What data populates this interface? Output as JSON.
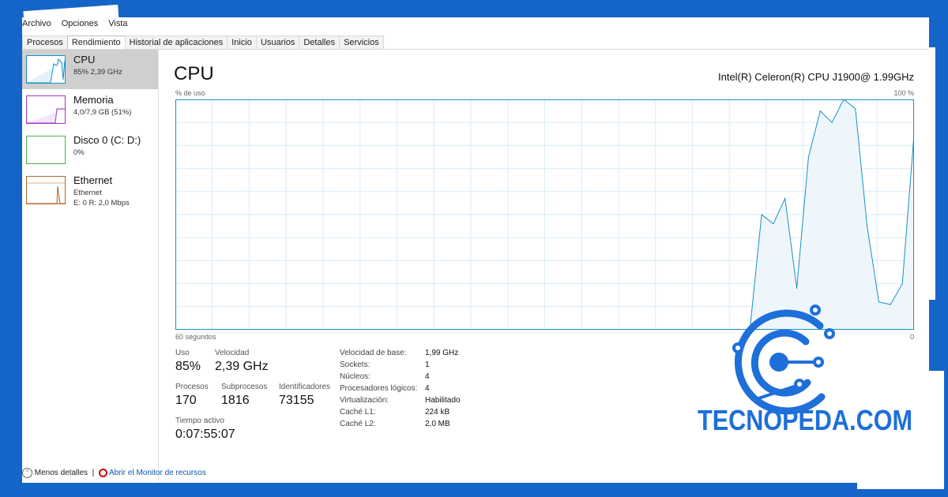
{
  "menu": [
    "Archivo",
    "Opciones",
    "Vista"
  ],
  "tabs": [
    "Procesos",
    "Rendimiento",
    "Historial de aplicaciones",
    "Inicio",
    "Usuarios",
    "Detalles",
    "Servicios"
  ],
  "active_tab_index": 1,
  "sidebar": {
    "items": [
      {
        "title": "CPU",
        "sub1": "85% 2,39 GHz",
        "sub2": "",
        "color": "#1a8fc8"
      },
      {
        "title": "Memoria",
        "sub1": "4,0/7,9 GB (51%)",
        "sub2": "",
        "color": "#a035c8"
      },
      {
        "title": "Disco 0 (C: D:)",
        "sub1": "0%",
        "sub2": "",
        "color": "#4caf50"
      },
      {
        "title": "Ethernet",
        "sub1": "Ethernet",
        "sub2": "E: 0 R: 2,0 Mbps",
        "color": "#b36a2a"
      }
    ]
  },
  "panel": {
    "title": "CPU",
    "processor": "Intel(R) Celeron(R) CPU J1900@ 1.99GHz",
    "y_label": "% de uso",
    "y_max_label": "100 %",
    "x_label": "60 segundos",
    "x_end_label": "0"
  },
  "chart_data": {
    "type": "area",
    "title": "CPU",
    "xlabel": "60 segundos",
    "ylabel": "% de uso",
    "ylim": [
      0,
      100
    ],
    "grid": true,
    "color": "#1a8fc8",
    "series": [
      {
        "values": [
          0,
          0,
          0,
          0,
          0,
          0,
          0,
          0,
          0,
          0,
          0,
          0,
          0,
          0,
          0,
          0,
          0,
          0,
          0,
          0,
          0,
          0,
          0,
          0,
          0,
          0,
          0,
          0,
          0,
          0,
          0,
          0,
          0,
          0,
          0,
          0,
          0,
          0,
          0,
          0,
          0,
          0,
          0,
          0,
          0,
          0,
          0,
          0,
          0,
          0,
          50,
          46,
          57,
          18,
          75,
          95,
          90,
          100,
          96,
          45,
          12,
          11,
          20,
          85
        ]
      }
    ]
  },
  "stats": {
    "uso_label": "Uso",
    "uso_value": "85%",
    "velocidad_label": "Velocidad",
    "velocidad_value": "2,39 GHz",
    "procesos_label": "Procesos",
    "procesos_value": "170",
    "subprocesos_label": "Subprocesos",
    "subprocesos_value": "1816",
    "identificadores_label": "Identificadores",
    "identificadores_value": "73155",
    "tiempo_label": "Tiempo activo",
    "tiempo_value": "0:07:55:07"
  },
  "props": [
    {
      "label": "Velocidad de base:",
      "value": "1,99 GHz"
    },
    {
      "label": "Sockets:",
      "value": "1"
    },
    {
      "label": "Núcleos:",
      "value": "4"
    },
    {
      "label": "Procesadores lógicos:",
      "value": "4"
    },
    {
      "label": "Virtualización:",
      "value": "Habilitado"
    },
    {
      "label": "Caché L1:",
      "value": "224 kB"
    },
    {
      "label": "Caché L2:",
      "value": "2,0 MB"
    }
  ],
  "footer": {
    "less_details": "Menos detalles",
    "resource_monitor": "Abrir el Monitor de recursos"
  },
  "brand": {
    "name": "TECNOPEDA.COM",
    "color": "#1e6fd9"
  }
}
